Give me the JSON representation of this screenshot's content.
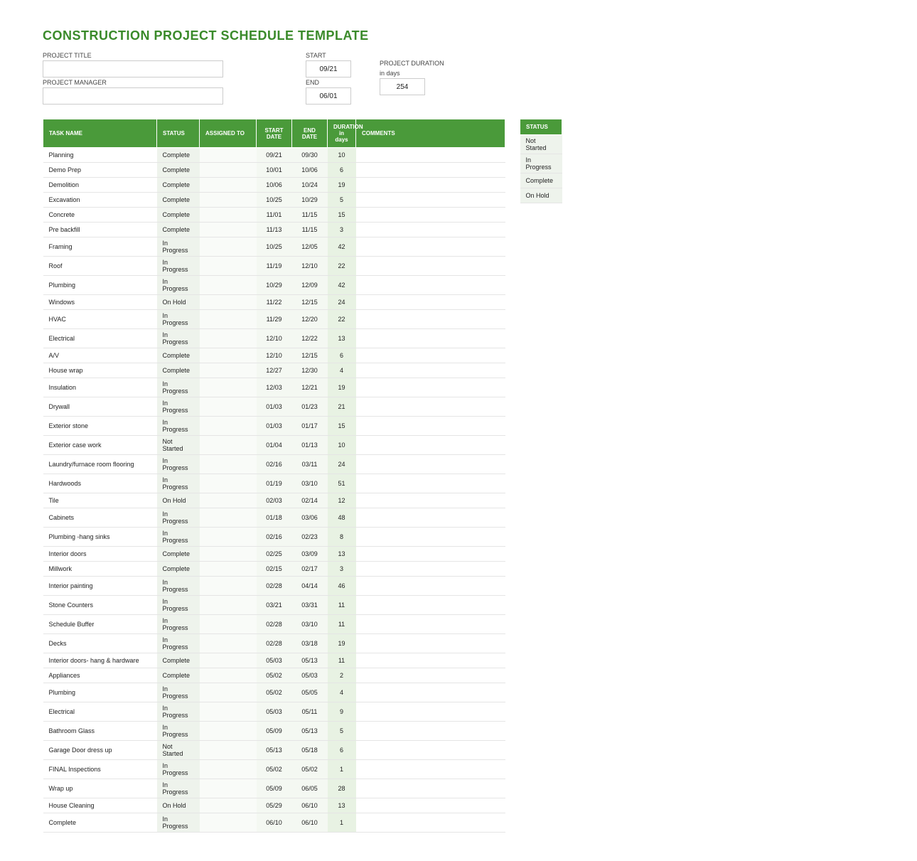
{
  "title": "CONSTRUCTION PROJECT SCHEDULE TEMPLATE",
  "meta": {
    "project_title_label": "PROJECT TITLE",
    "project_title_value": "",
    "project_manager_label": "PROJECT MANAGER",
    "project_manager_value": "",
    "start_label": "START",
    "start_value": "09/21",
    "end_label": "END",
    "end_value": "06/01",
    "duration_label": "PROJECT DURATION",
    "duration_sub": "in days",
    "duration_value": "254"
  },
  "headers": {
    "task": "TASK NAME",
    "status": "STATUS",
    "assigned": "ASSIGNED TO",
    "start": "START DATE",
    "end": "END DATE",
    "duration": "DURATION in days",
    "comments": "COMMENTS"
  },
  "legend_header": "STATUS",
  "legend": [
    "Not Started",
    "In Progress",
    "Complete",
    "On Hold"
  ],
  "rows": [
    {
      "task": "Planning",
      "status": "Complete",
      "start": "09/21",
      "end": "09/30",
      "dur": "10"
    },
    {
      "task": "Demo Prep",
      "status": "Complete",
      "start": "10/01",
      "end": "10/06",
      "dur": "6"
    },
    {
      "task": "Demolition",
      "status": "Complete",
      "start": "10/06",
      "end": "10/24",
      "dur": "19"
    },
    {
      "task": "Excavation",
      "status": "Complete",
      "start": "10/25",
      "end": "10/29",
      "dur": "5"
    },
    {
      "task": "Concrete",
      "status": "Complete",
      "start": "11/01",
      "end": "11/15",
      "dur": "15"
    },
    {
      "task": "Pre backfill",
      "status": "Complete",
      "start": "11/13",
      "end": "11/15",
      "dur": "3"
    },
    {
      "task": "Framing",
      "status": "In Progress",
      "start": "10/25",
      "end": "12/05",
      "dur": "42"
    },
    {
      "task": "Roof",
      "status": "In Progress",
      "start": "11/19",
      "end": "12/10",
      "dur": "22"
    },
    {
      "task": "Plumbing",
      "status": "In Progress",
      "start": "10/29",
      "end": "12/09",
      "dur": "42"
    },
    {
      "task": "Windows",
      "status": "On Hold",
      "start": "11/22",
      "end": "12/15",
      "dur": "24"
    },
    {
      "task": "HVAC",
      "status": "In Progress",
      "start": "11/29",
      "end": "12/20",
      "dur": "22"
    },
    {
      "task": "Electrical",
      "status": "In Progress",
      "start": "12/10",
      "end": "12/22",
      "dur": "13"
    },
    {
      "task": "A/V",
      "status": "Complete",
      "start": "12/10",
      "end": "12/15",
      "dur": "6"
    },
    {
      "task": "House wrap",
      "status": "Complete",
      "start": "12/27",
      "end": "12/30",
      "dur": "4"
    },
    {
      "task": "Insulation",
      "status": "In Progress",
      "start": "12/03",
      "end": "12/21",
      "dur": "19"
    },
    {
      "task": "Drywall",
      "status": "In Progress",
      "start": "01/03",
      "end": "01/23",
      "dur": "21"
    },
    {
      "task": "Exterior stone",
      "status": "In Progress",
      "start": "01/03",
      "end": "01/17",
      "dur": "15"
    },
    {
      "task": "Exterior case work",
      "status": "Not Started",
      "start": "01/04",
      "end": "01/13",
      "dur": "10"
    },
    {
      "task": "Laundry/furnace room flooring",
      "status": "In Progress",
      "start": "02/16",
      "end": "03/11",
      "dur": "24"
    },
    {
      "task": "Hardwoods",
      "status": "In Progress",
      "start": "01/19",
      "end": "03/10",
      "dur": "51"
    },
    {
      "task": "Tile",
      "status": "On Hold",
      "start": "02/03",
      "end": "02/14",
      "dur": "12"
    },
    {
      "task": "Cabinets",
      "status": "In Progress",
      "start": "01/18",
      "end": "03/06",
      "dur": "48"
    },
    {
      "task": "Plumbing -hang sinks",
      "status": "In Progress",
      "start": "02/16",
      "end": "02/23",
      "dur": "8"
    },
    {
      "task": "Interior doors",
      "status": "Complete",
      "start": "02/25",
      "end": "03/09",
      "dur": "13"
    },
    {
      "task": "Millwork",
      "status": "Complete",
      "start": "02/15",
      "end": "02/17",
      "dur": "3"
    },
    {
      "task": "Interior painting",
      "status": "In Progress",
      "start": "02/28",
      "end": "04/14",
      "dur": "46"
    },
    {
      "task": "Stone Counters",
      "status": "In Progress",
      "start": "03/21",
      "end": "03/31",
      "dur": "11"
    },
    {
      "task": "Schedule Buffer",
      "status": "In Progress",
      "start": "02/28",
      "end": "03/10",
      "dur": "11"
    },
    {
      "task": "Decks",
      "status": "In Progress",
      "start": "02/28",
      "end": "03/18",
      "dur": "19"
    },
    {
      "task": "Interior doors- hang & hardware",
      "status": "Complete",
      "start": "05/03",
      "end": "05/13",
      "dur": "11"
    },
    {
      "task": "Appliances",
      "status": "Complete",
      "start": "05/02",
      "end": "05/03",
      "dur": "2"
    },
    {
      "task": "Plumbing",
      "status": "In Progress",
      "start": "05/02",
      "end": "05/05",
      "dur": "4"
    },
    {
      "task": "Electrical",
      "status": "In Progress",
      "start": "05/03",
      "end": "05/11",
      "dur": "9"
    },
    {
      "task": "Bathroom Glass",
      "status": "In Progress",
      "start": "05/09",
      "end": "05/13",
      "dur": "5"
    },
    {
      "task": "Garage Door dress up",
      "status": "Not Started",
      "start": "05/13",
      "end": "05/18",
      "dur": "6"
    },
    {
      "task": "FINAL Inspections",
      "status": "In Progress",
      "start": "05/02",
      "end": "05/02",
      "dur": "1"
    },
    {
      "task": "Wrap up",
      "status": "In Progress",
      "start": "05/09",
      "end": "06/05",
      "dur": "28"
    },
    {
      "task": "House Cleaning",
      "status": "On Hold",
      "start": "05/29",
      "end": "06/10",
      "dur": "13"
    },
    {
      "task": "Complete",
      "status": "In Progress",
      "start": "06/10",
      "end": "06/10",
      "dur": "1"
    }
  ]
}
